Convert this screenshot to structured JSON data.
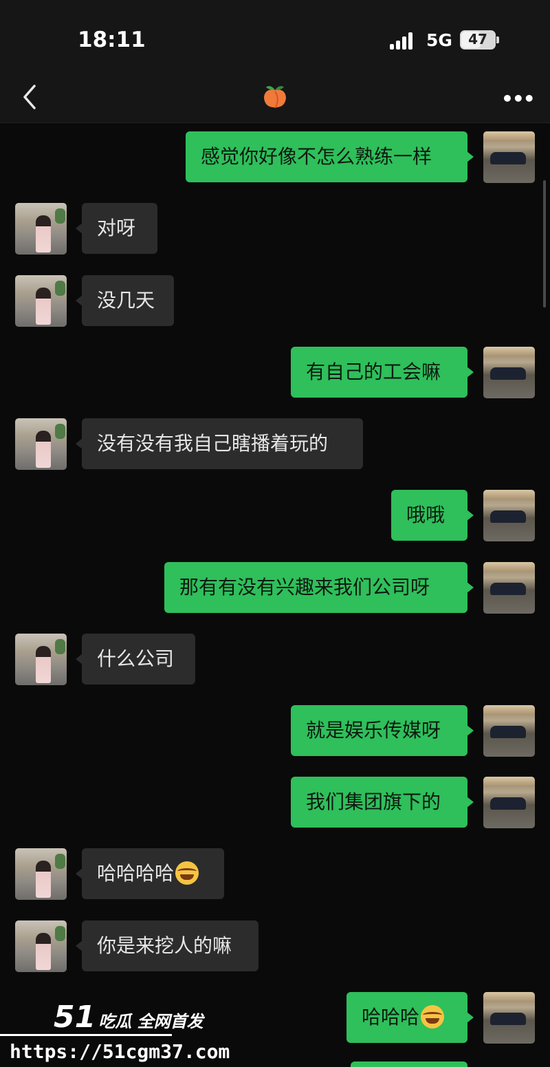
{
  "status_bar": {
    "time": "18:11",
    "network": "5G",
    "battery": "47"
  },
  "nav": {
    "title_icon": "peach-emoji",
    "back_icon": "chevron-left-icon",
    "more_icon": "more-icon",
    "more_text": "•••"
  },
  "messages": [
    {
      "sender": "me",
      "text": "感觉你好像不怎么熟练一样"
    },
    {
      "sender": "her",
      "text": "对呀"
    },
    {
      "sender": "her",
      "text": "没几天"
    },
    {
      "sender": "me",
      "text": "有自己的工会嘛"
    },
    {
      "sender": "her",
      "text": "没有没有我自己瞎播着玩的"
    },
    {
      "sender": "me",
      "text": "哦哦"
    },
    {
      "sender": "me",
      "text": "那有有没有兴趣来我们公司呀"
    },
    {
      "sender": "her",
      "text": "什么公司"
    },
    {
      "sender": "me",
      "text": "就是娱乐传媒呀"
    },
    {
      "sender": "me",
      "text": "我们集团旗下的"
    },
    {
      "sender": "her",
      "text": "哈哈哈哈",
      "emoji": "joy-emoji"
    },
    {
      "sender": "her",
      "text": "你是来挖人的嘛"
    },
    {
      "sender": "me",
      "text": "哈哈哈",
      "emoji": "joy-emoji"
    }
  ],
  "watermark": {
    "number": "51",
    "text": "吃瓜 全网首发",
    "url": "https://51cgm37.com"
  },
  "colors": {
    "bubble_me": "#2fbf5b",
    "bubble_her": "#2c2c2c",
    "background": "#0a0a0a"
  }
}
